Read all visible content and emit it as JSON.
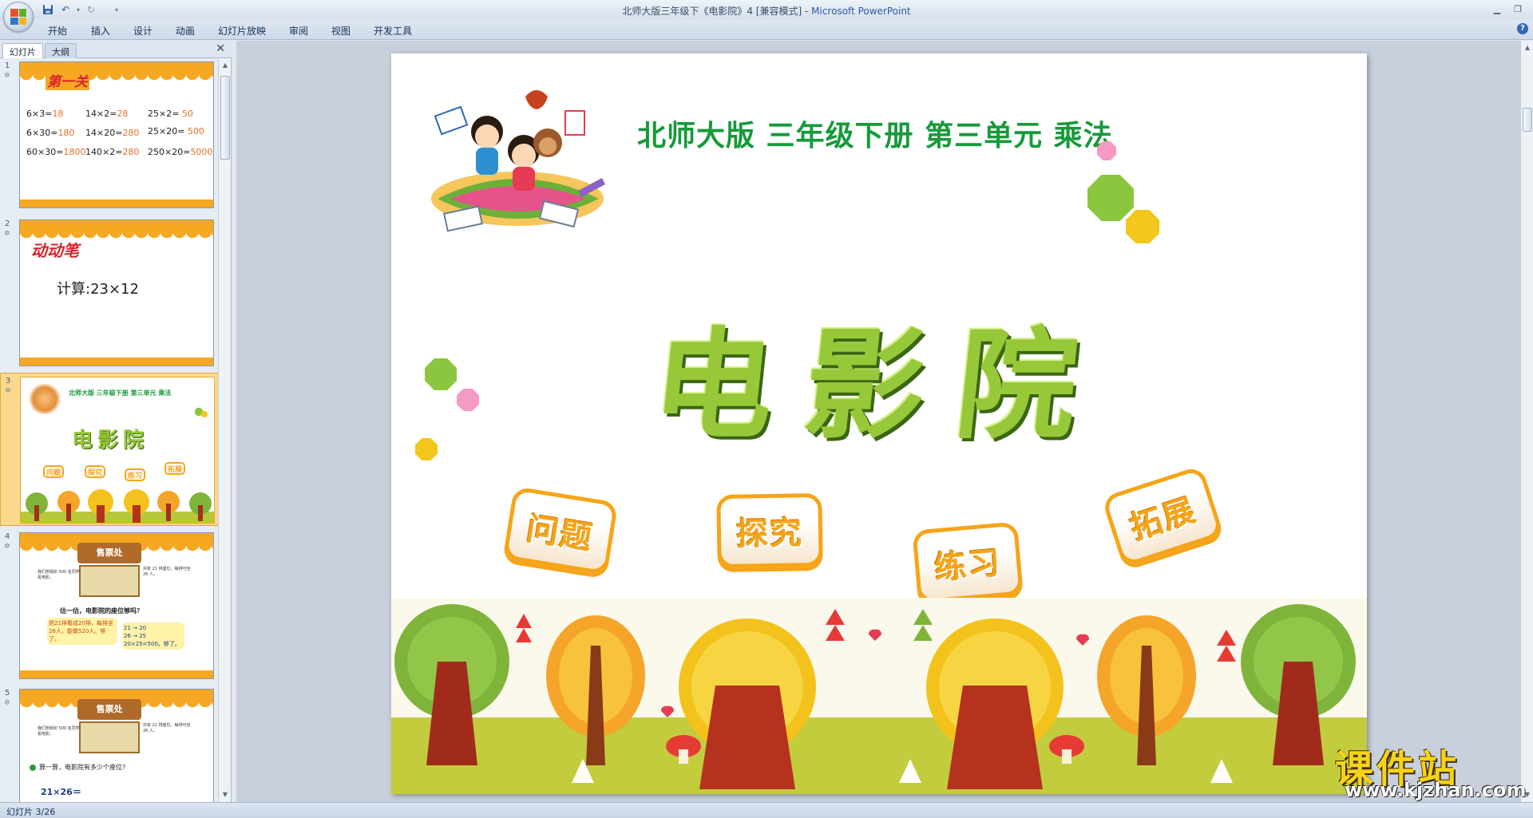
{
  "window": {
    "title": "北师大版三年级下《电影院》4 [兼容模式] - ",
    "app_name": "Microsoft PowerPoint"
  },
  "ribbon": {
    "tabs": [
      "开始",
      "插入",
      "设计",
      "动画",
      "幻灯片放映",
      "审阅",
      "视图",
      "开发工具"
    ]
  },
  "left_pane": {
    "tabs": {
      "slides": "幻灯片",
      "outline": "大纲"
    },
    "thumbnails": [
      {
        "num": "1",
        "heading": "第一关",
        "rows": [
          [
            [
              "6×3=",
              "18"
            ],
            [
              "14×2=",
              "28"
            ],
            [
              "25×2=",
              "50"
            ]
          ],
          [
            [
              "6×30=",
              "180"
            ],
            [
              "14×20=",
              "280"
            ],
            [
              "25×20=",
              "500"
            ]
          ],
          [
            [
              "60×30=",
              "1800"
            ],
            [
              "140×2=",
              "280"
            ],
            [
              "250×20=",
              "5000"
            ]
          ]
        ]
      },
      {
        "num": "2",
        "heading": "动动笔",
        "text": "计算:23×12"
      },
      {
        "num": "3",
        "selected": true,
        "header": "北师大版  三年级下册  第三单元  乘法",
        "title": "电影院",
        "badges": [
          "问题",
          "探究",
          "练习",
          "拓展"
        ]
      },
      {
        "num": "4",
        "sign": "售票处",
        "bubble_left": "我们想组织 500 名同学看电影。",
        "bubble_right": "共有 21 排座位，每排可坐 26 人。",
        "question": "估一估，电影院的座位够吗？",
        "answer_left": "把21排看成20排，每排坐26人，能做520人。够了。",
        "calc": [
          "21 → 20",
          "26 → 25",
          "20×25=500。够了。"
        ]
      },
      {
        "num": "5",
        "sign": "售票处",
        "bubble_left": "我们想组织 500 名同学看电影。",
        "bubble_right": "共有 21 排座位，每排可坐 26 人。",
        "question": "算一算，电影院有多少个座位?",
        "calc": "21×26＝"
      }
    ]
  },
  "slide": {
    "header": "北师大版  三年级下册  第三单元  乘法",
    "title": "电影院",
    "badges": [
      "问题",
      "探究",
      "练习",
      "拓展"
    ],
    "colors": {
      "header": "#169a3a",
      "title": "#96c83a",
      "badge": "#f6a418"
    }
  },
  "status": {
    "slide_indicator": "幻灯片 3/26"
  },
  "watermark": {
    "brand": "课件站",
    "url": "www.kjzhan.com"
  }
}
